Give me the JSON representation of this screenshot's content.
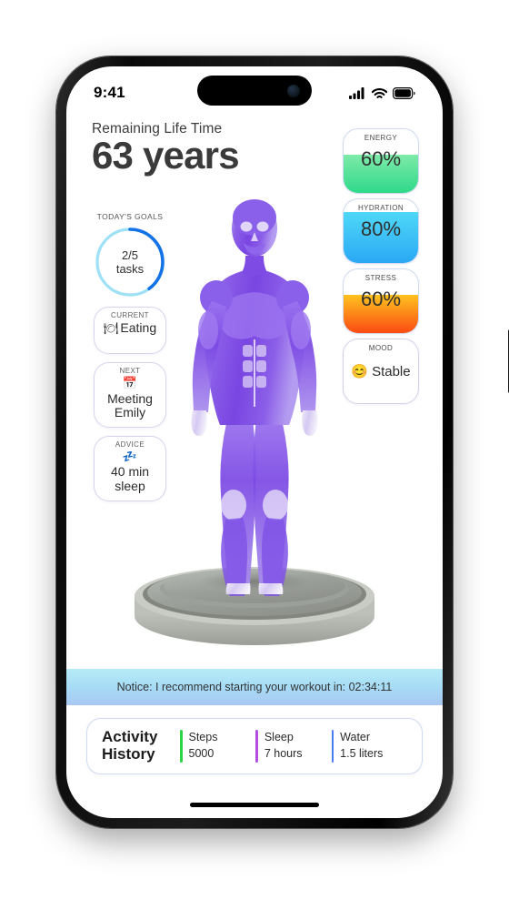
{
  "status_bar": {
    "time": "9:41",
    "icons": [
      "cellular-signal-icon",
      "wifi-icon",
      "battery-icon"
    ]
  },
  "header": {
    "subtitle": "Remaining Life Time",
    "title": "63 years"
  },
  "goals": {
    "label": "TODAY'S GOALS",
    "value": "2/5",
    "unit": "tasks",
    "completed": 2,
    "total": 5,
    "percent": 40,
    "track_color": "#9ee0f5",
    "progress_color": "#1473e6"
  },
  "left_cards": [
    {
      "label": "CURRENT",
      "emoji": "🍽",
      "icon_name": "plate-cutlery-icon",
      "value": "Eating"
    },
    {
      "label": "NEXT",
      "emoji": "📅",
      "icon_name": "calendar-icon",
      "value": "Meeting Emily"
    },
    {
      "label": "ADVICE",
      "emoji": "💤",
      "icon_name": "sleep-zzz-icon",
      "value": "40 min sleep"
    }
  ],
  "stat_cards": [
    {
      "label": "ENERGY",
      "value": "60%",
      "percent": 60,
      "color_from": "#7eeaa8",
      "color_to": "#2fd98a"
    },
    {
      "label": "HYDRATION",
      "value": "80%",
      "percent": 80,
      "color_from": "#4fd8f7",
      "color_to": "#2aa8f5"
    },
    {
      "label": "STRESS",
      "value": "60%",
      "percent": 60,
      "color_from": "#ffc21f",
      "color_to": "#fb4a12"
    }
  ],
  "mood_card": {
    "label": "MOOD",
    "emoji": "😊",
    "icon_name": "smiling-face-icon",
    "value": "Stable"
  },
  "notice": {
    "text": "Notice: I recommend starting your workout in: 02:34:11"
  },
  "activity": {
    "title": "Activity History",
    "metrics": [
      {
        "name": "Steps",
        "value": "5000",
        "color": "#27d545"
      },
      {
        "name": "Sleep",
        "value": "7 hours",
        "color": "#b44be0"
      },
      {
        "name": "Water",
        "value": "1.5 liters",
        "color": "#4a7bf0"
      }
    ]
  },
  "figure": {
    "name": "anatomical-muscle-body-model",
    "body_color": "#7d4de0",
    "platform_color": "#a9aca6"
  }
}
